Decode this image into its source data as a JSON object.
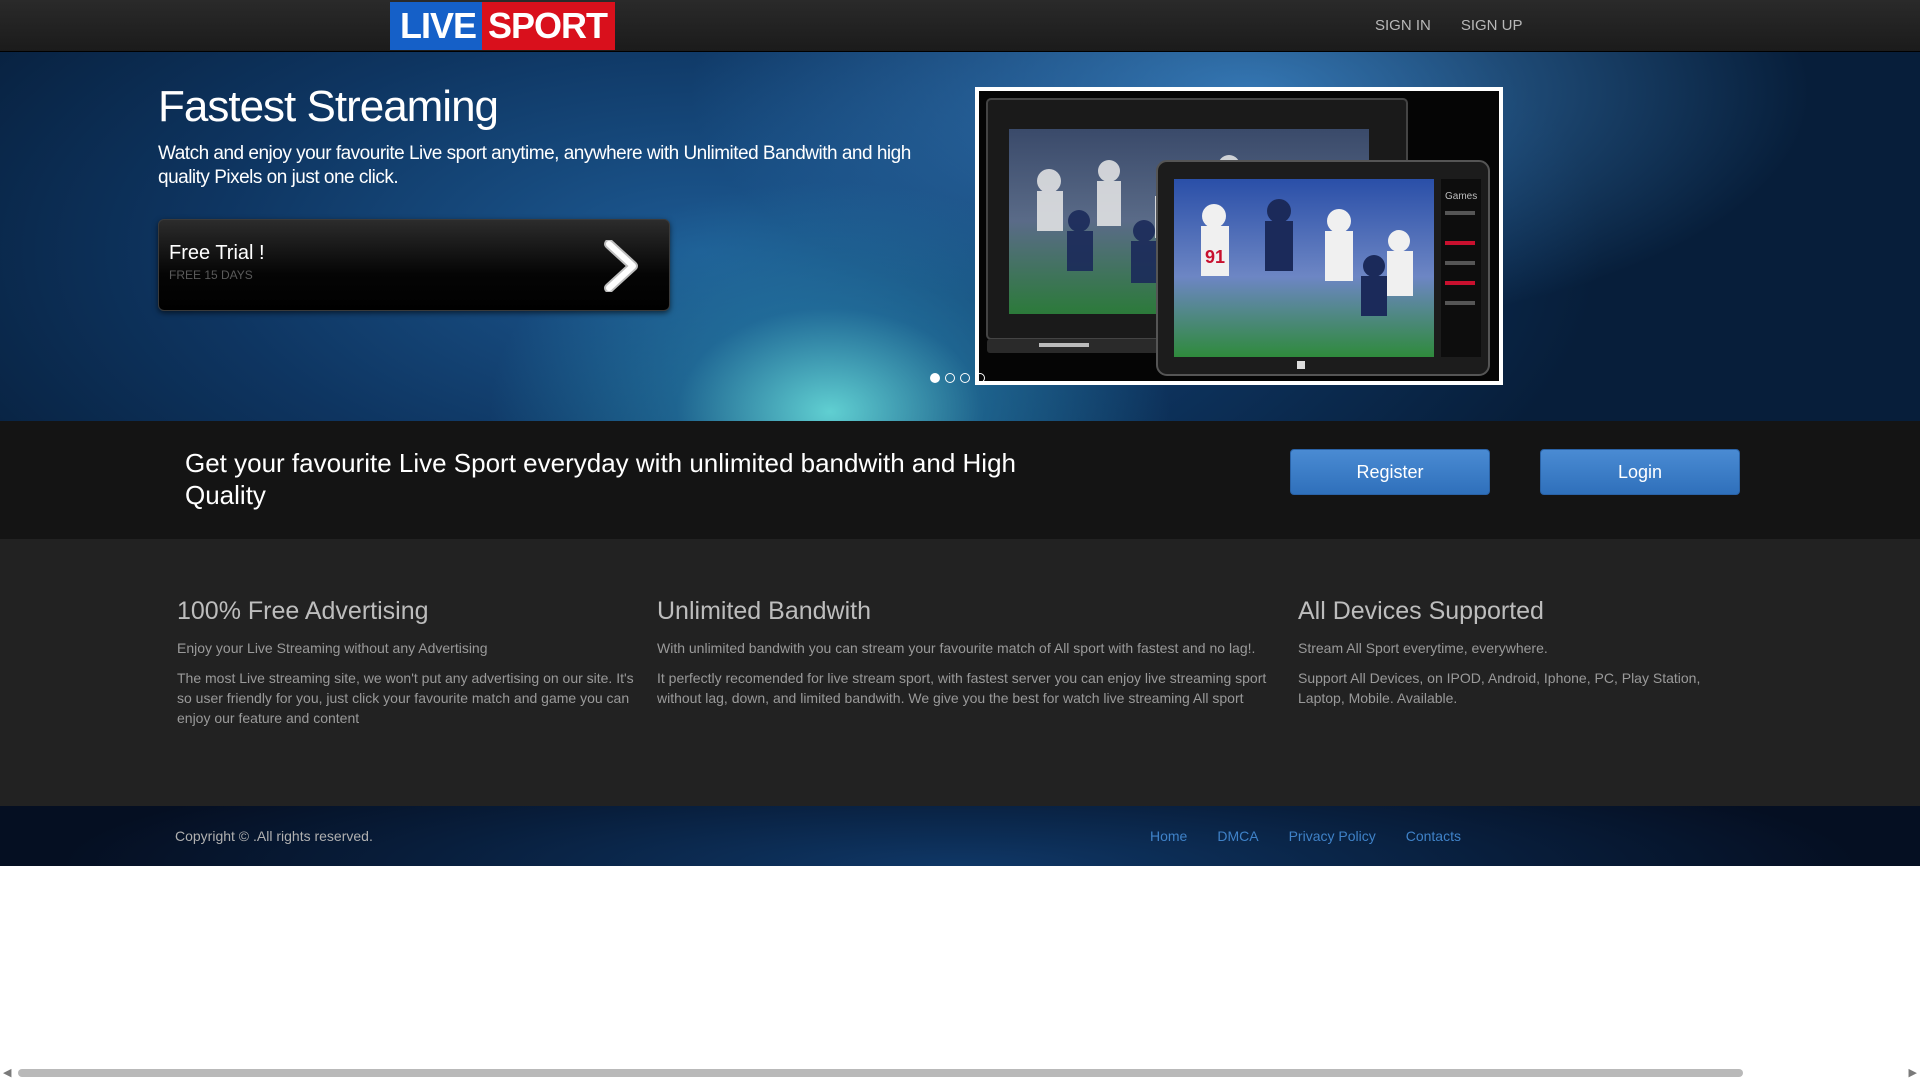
{
  "header": {
    "logo": {
      "part1": "LIVE",
      "part2": "SPORT"
    },
    "nav": [
      {
        "label": "SIGN IN"
      },
      {
        "label": "SIGN UP"
      }
    ]
  },
  "hero": {
    "title": "Fastest Streaming",
    "text": "Watch and enjoy your favourite Live sport anytime, anywhere with Unlimited Bandwith and high quality Pixels on just one click.",
    "trial": {
      "title": "Free Trial !",
      "subtitle": "FREE 15 DAYS"
    },
    "slider": {
      "image": "devices-football-streaming",
      "side_panel_label": "Games",
      "jersey_number": "91",
      "dots": 4,
      "active_dot": 1
    }
  },
  "cta": {
    "text": "Get your favourite Live Sport everyday with unlimited bandwith and High Quality",
    "register_label": "Register",
    "login_label": "Login"
  },
  "features": [
    {
      "title": "100% Free Advertising",
      "lead": "Enjoy your Live Streaming without any Advertising",
      "body": "The most Live streaming site, we won't put any advertising on our site. It's so user friendly for you, just click your favourite match and game you can enjoy our feature and content"
    },
    {
      "title": "Unlimited Bandwith",
      "lead": "With unlimited bandwith you can stream your favourite match of All sport with fastest and no lag!.",
      "body": "It perfectly recomended for live stream sport, with fastest server you can enjoy live streaming sport without lag, down, and limited bandwith. We give you the best for watch live streaming All sport"
    },
    {
      "title": "All Devices Supported",
      "lead": "Stream All Sport everytime, everywhere.",
      "body": "Support All Devices, on IPOD, Android, Iphone, PC, Play Station, Laptop, Mobile. Available."
    }
  ],
  "footer": {
    "copyright": "Copyright © .All rights reserved.",
    "links": [
      {
        "label": "Home"
      },
      {
        "label": "DMCA"
      },
      {
        "label": "Privacy Policy"
      },
      {
        "label": "Contacts"
      }
    ]
  },
  "scrollbar": {
    "left_icon": "triangle-left-icon",
    "right_icon": "triangle-right-icon"
  },
  "colors": {
    "brand_blue": "#1560c8",
    "brand_red": "#d9101c",
    "button_blue": "#3a7cc6",
    "link_blue": "#3f82c8"
  }
}
